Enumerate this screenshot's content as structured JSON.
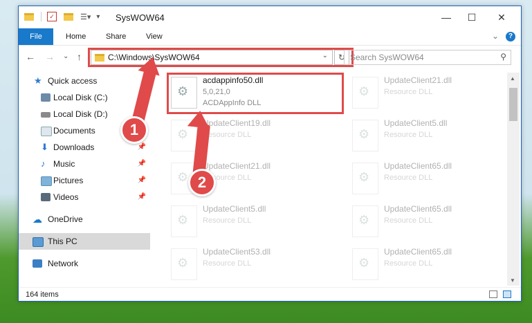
{
  "window": {
    "title": "SysWOW64",
    "minimize_label": "—",
    "maximize_label": "☐",
    "close_label": "✕"
  },
  "ribbon": {
    "tabs": [
      {
        "label": "File"
      },
      {
        "label": "Home"
      },
      {
        "label": "Share"
      },
      {
        "label": "View"
      }
    ],
    "expand_label": "⌄",
    "help_label": "?"
  },
  "nav": {
    "back": "←",
    "forward": "→",
    "recent": "⌄",
    "up": "↑",
    "address": "C:\\Windows\\SysWOW64",
    "dropdown": "⌄",
    "refresh": "↻",
    "search_placeholder": "Search SysWOW64"
  },
  "sidebar": {
    "items": [
      {
        "label": "Quick access"
      },
      {
        "label": "Local Disk (C:)"
      },
      {
        "label": "Local Disk (D:)"
      },
      {
        "label": "Documents"
      },
      {
        "label": "Downloads"
      },
      {
        "label": "Music"
      },
      {
        "label": "Pictures"
      },
      {
        "label": "Videos"
      },
      {
        "label": "OneDrive"
      },
      {
        "label": "This PC"
      },
      {
        "label": "Network"
      }
    ]
  },
  "files": {
    "highlighted": {
      "name": "acdappinfo50.dll",
      "version": "5,0,21,0",
      "description": "ACDAppInfo DLL"
    },
    "left": [
      {
        "name": "UpdateClient19.dll",
        "type": "Resource DLL"
      },
      {
        "name": "UpdateClient21.dll",
        "type": "Resource DLL"
      },
      {
        "name": "UpdateClient5.dll",
        "type": "Resource DLL"
      },
      {
        "name": "UpdateClient53.dll",
        "type": "Resource DLL"
      }
    ],
    "right": [
      {
        "name": "UpdateClient21.dll",
        "type": "Resource DLL"
      },
      {
        "name": "UpdateClient5.dll",
        "type": "Resource DLL"
      },
      {
        "name": "UpdateClient65.dll",
        "type": "Resource DLL"
      },
      {
        "name": "UpdateClient65.dll",
        "type": "Resource DLL"
      },
      {
        "name": "UpdateClient65.dll",
        "type": "Resource DLL"
      }
    ]
  },
  "status": {
    "items": "164 items"
  },
  "annotations": {
    "step1": "1",
    "step2": "2"
  },
  "colors": {
    "accent": "#1979ca",
    "highlight": "#e04a4a"
  }
}
